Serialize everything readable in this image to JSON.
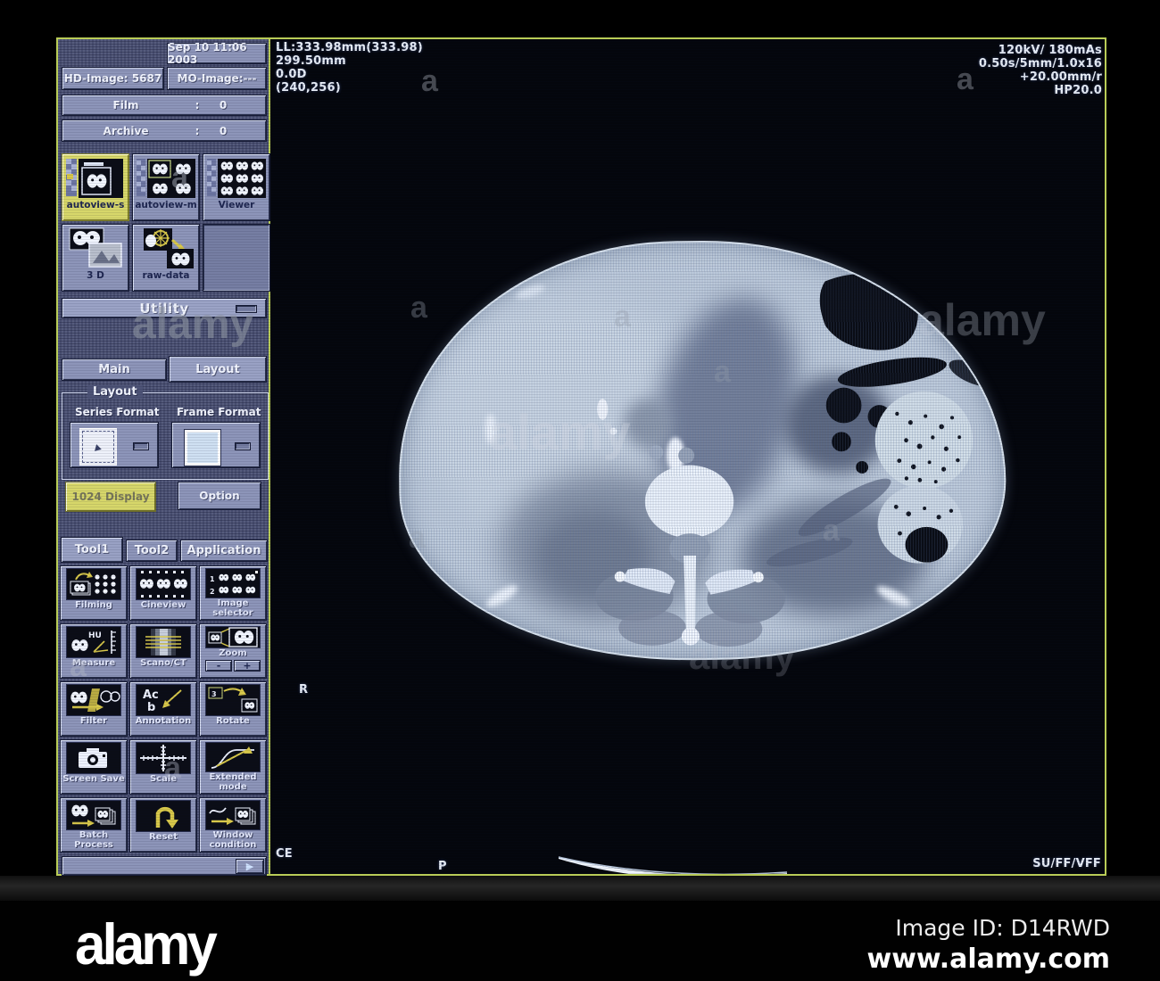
{
  "header": {
    "date": "Sep 10 11:06 2003",
    "hd": "HD-Image: 5687",
    "mo": "MO-Image:---",
    "film": {
      "label": "Film",
      "sep": ":",
      "value": "0"
    },
    "archive": {
      "label": "Archive",
      "sep": ":",
      "value": "0"
    }
  },
  "launcher": {
    "items": [
      {
        "label": "autoview-s",
        "selected": true
      },
      {
        "label": "autoview-m",
        "selected": false
      },
      {
        "label": "Viewer",
        "selected": false
      },
      {
        "label": "3 D",
        "selected": false
      },
      {
        "label": "raw-data",
        "selected": false
      }
    ],
    "utility": "Utility"
  },
  "layout_panel": {
    "tabs": {
      "main": "Main",
      "layout": "Layout"
    },
    "active_tab": "Layout",
    "group_title": "Layout",
    "series_label": "Series Format",
    "frame_label": "Frame Format",
    "display_button": "1024 Display",
    "option_button": "Option"
  },
  "tools": {
    "tabs": {
      "t1": "Tool1",
      "t2": "Tool2",
      "app": "Application"
    },
    "active_tab": "Tool1",
    "buttons": [
      "Filming",
      "Cineview",
      "Image selector",
      "Measure",
      "Scano/CT",
      "Zoom",
      "Filter",
      "Annotation",
      "Rotate",
      "Screen Save",
      "Scale",
      "Extended mode",
      "Batch Process",
      "Reset",
      "Window condition"
    ],
    "zoom_minus": "-",
    "zoom_plus": "+"
  },
  "viewport": {
    "top_left": [
      "LL:333.98mm(333.98)",
      "299.50mm",
      "0.0D",
      "(240,256)"
    ],
    "top_right": [
      "120kV/ 180mAs",
      "0.50s/5mm/1.0x16",
      "+20.00mm/r",
      "HP20.0"
    ],
    "marker_r": "R",
    "bottom_left": "CE",
    "bottom_center": "P",
    "bottom_right": "SU/FF/VFF"
  },
  "watermark": {
    "logo": "alamy",
    "small": "a",
    "image_id": "Image ID: D14RWD",
    "url": "www.alamy.com"
  },
  "colors": {
    "screen_border": "#b9cc57",
    "highlight_yellow": "#d7d76a",
    "panel_bg": "#4d5376",
    "panel_raised": "#8d95b9",
    "icon_accent": "#d8c84a"
  }
}
